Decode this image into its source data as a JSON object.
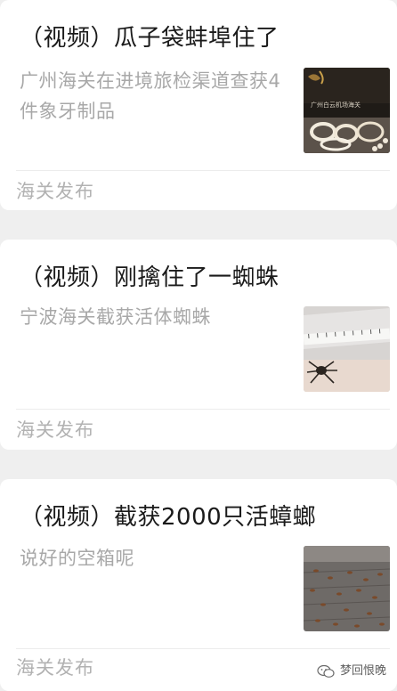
{
  "articles": [
    {
      "title": "（视频）瓜子袋蚌埠住了",
      "summary": "广州海关在进境旅检渠道查获4件象牙制品",
      "thumbnail": "ivory-bracelets-thumbnail",
      "thumbnail_caption": "广州白云机场海关",
      "source": "海关发布"
    },
    {
      "title": "（视频）刚擒住了一蜘蛛",
      "summary": "宁波海关截获活体蜘蛛",
      "thumbnail": "spider-with-ruler-thumbnail",
      "source": "海关发布"
    },
    {
      "title": "（视频）截获2000只活蟑螂",
      "summary": "说好的空箱呢",
      "thumbnail": "cockroaches-in-container-thumbnail",
      "source": "海关发布"
    }
  ],
  "watermark": {
    "icon": "wechat-icon",
    "text": "梦回恨晚"
  }
}
